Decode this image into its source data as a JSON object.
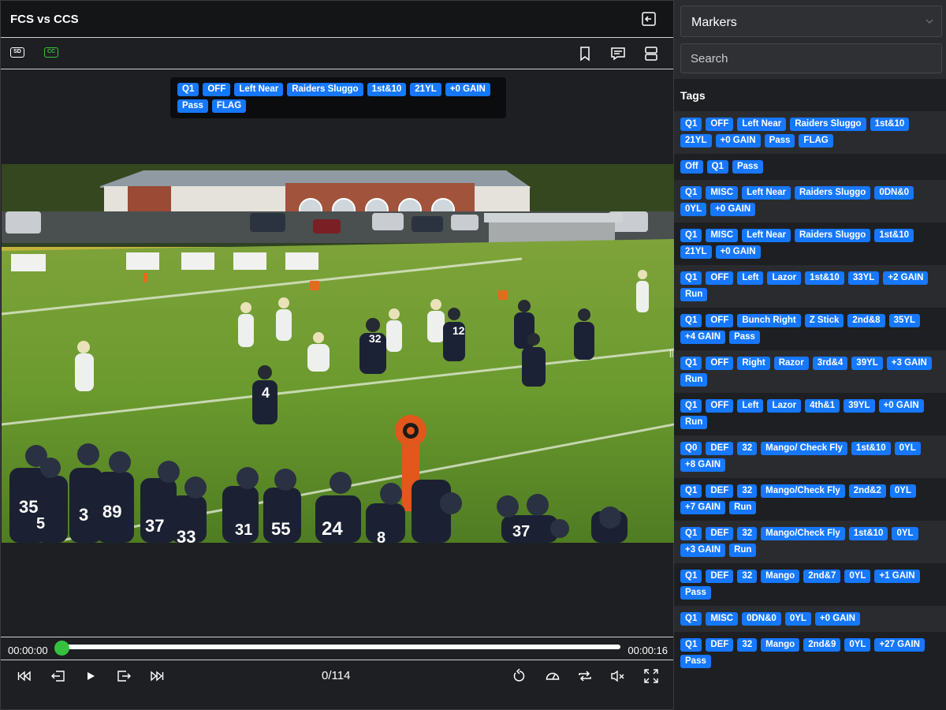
{
  "header": {
    "title": "FCS vs CCS"
  },
  "toolbar": {
    "sd_label": "SD",
    "cc_label": "CC"
  },
  "overlay_tags": [
    "Q1",
    "OFF",
    "Left Near",
    "Raiders Sluggo",
    "1st&10",
    "21YL",
    "+0 GAIN",
    "Pass",
    "FLAG"
  ],
  "player": {
    "time_current": "00:00:00",
    "time_total": "00:00:16",
    "progress": 0,
    "counter": "0/114"
  },
  "sidebar": {
    "select_value": "Markers",
    "search_placeholder": "Search",
    "tags_heading": "Tags",
    "items": [
      [
        "Q1",
        "OFF",
        "Left Near",
        "Raiders Sluggo",
        "1st&10",
        "21YL",
        "+0 GAIN",
        "Pass",
        "FLAG"
      ],
      [
        "Off",
        "Q1",
        "Pass"
      ],
      [
        "Q1",
        "MISC",
        "Left Near",
        "Raiders Sluggo",
        "0DN&0",
        "0YL",
        "+0 GAIN"
      ],
      [
        "Q1",
        "MISC",
        "Left Near",
        "Raiders Sluggo",
        "1st&10",
        "21YL",
        "+0 GAIN"
      ],
      [
        "Q1",
        "OFF",
        "Left",
        "Lazor",
        "1st&10",
        "33YL",
        "+2 GAIN",
        "Run"
      ],
      [
        "Q1",
        "OFF",
        "Bunch Right",
        "Z Stick",
        "2nd&8",
        "35YL",
        "+4 GAIN",
        "Pass"
      ],
      [
        "Q1",
        "OFF",
        "Right",
        "Razor",
        "3rd&4",
        "39YL",
        "+3 GAIN",
        "Run"
      ],
      [
        "Q1",
        "OFF",
        "Left",
        "Lazor",
        "4th&1",
        "39YL",
        "+0 GAIN",
        "Run"
      ],
      [
        "Q0",
        "DEF",
        "32",
        "Mango/ Check Fly",
        "1st&10",
        "0YL",
        "+8 GAIN"
      ],
      [
        "Q1",
        "DEF",
        "32",
        "Mango/Check Fly",
        "2nd&2",
        "0YL",
        "+7 GAIN",
        "Run"
      ],
      [
        "Q1",
        "DEF",
        "32",
        "Mango/Check Fly",
        "1st&10",
        "0YL",
        "+3 GAIN",
        "Run"
      ],
      [
        "Q1",
        "DEF",
        "32",
        "Mango",
        "2nd&7",
        "0YL",
        "+1 GAIN",
        "Pass"
      ],
      [
        "Q1",
        "MISC",
        "0DN&0",
        "0YL",
        "+0 GAIN"
      ],
      [
        "Q1",
        "DEF",
        "32",
        "Mango",
        "2nd&9",
        "0YL",
        "+27 GAIN",
        "Pass"
      ]
    ]
  },
  "video": {
    "jersey_numbers": [
      "35",
      "5",
      "3",
      "89",
      "37",
      "33",
      "31",
      "55",
      "24",
      "8",
      "37",
      "4",
      "32",
      "12"
    ]
  },
  "colors": {
    "tag": "#1677ff",
    "accent": "#35c13d"
  }
}
